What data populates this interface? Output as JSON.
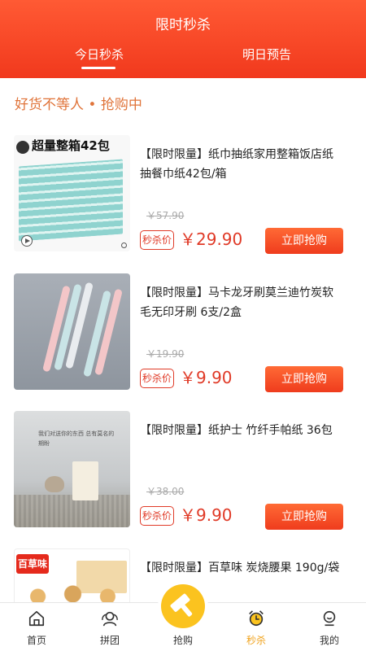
{
  "header": {
    "title": "限时秒杀"
  },
  "tabs": [
    {
      "label": "今日秒杀",
      "active": true
    },
    {
      "label": "明日预告",
      "active": false
    }
  ],
  "section_title": "好货不等人 • 抢购中",
  "products": [
    {
      "title": "【限时限量】纸巾抽纸家用整箱饭店纸抽餐巾纸42包/箱",
      "image_badge": "超量整箱42包",
      "original_price": "￥57.90",
      "tag": "秒杀价",
      "price": "￥29.90",
      "button": "立即抢购"
    },
    {
      "title": "【限时限量】马卡龙牙刷莫兰迪竹炭软毛无印牙刷 6支/2盒",
      "original_price": "￥19.90",
      "tag": "秒杀价",
      "price": "￥9.90",
      "button": "立即抢购"
    },
    {
      "title": "【限时限量】纸护士 竹纤手帕纸 36包",
      "image_text": "我们对送你的东西 总有莫名的期盼",
      "original_price": "￥38.00",
      "tag": "秒杀价",
      "price": "￥9.90",
      "button": "立即抢购"
    },
    {
      "title": "【限时限量】百草味 炭烧腰果 190g/袋",
      "image_logo": "百草味"
    }
  ],
  "bottom_nav": [
    {
      "label": "首页",
      "icon": "home-icon"
    },
    {
      "label": "拼团",
      "icon": "group-icon"
    },
    {
      "label": "抢购",
      "icon": "hammer-icon"
    },
    {
      "label": "秒杀",
      "icon": "alarm-clock-icon",
      "active": true
    },
    {
      "label": "我的",
      "icon": "user-icon"
    }
  ],
  "colors": {
    "header": "#f1391d",
    "price": "#e03a27",
    "active_nav": "#f0a21b",
    "section_title": "#e0743a"
  }
}
